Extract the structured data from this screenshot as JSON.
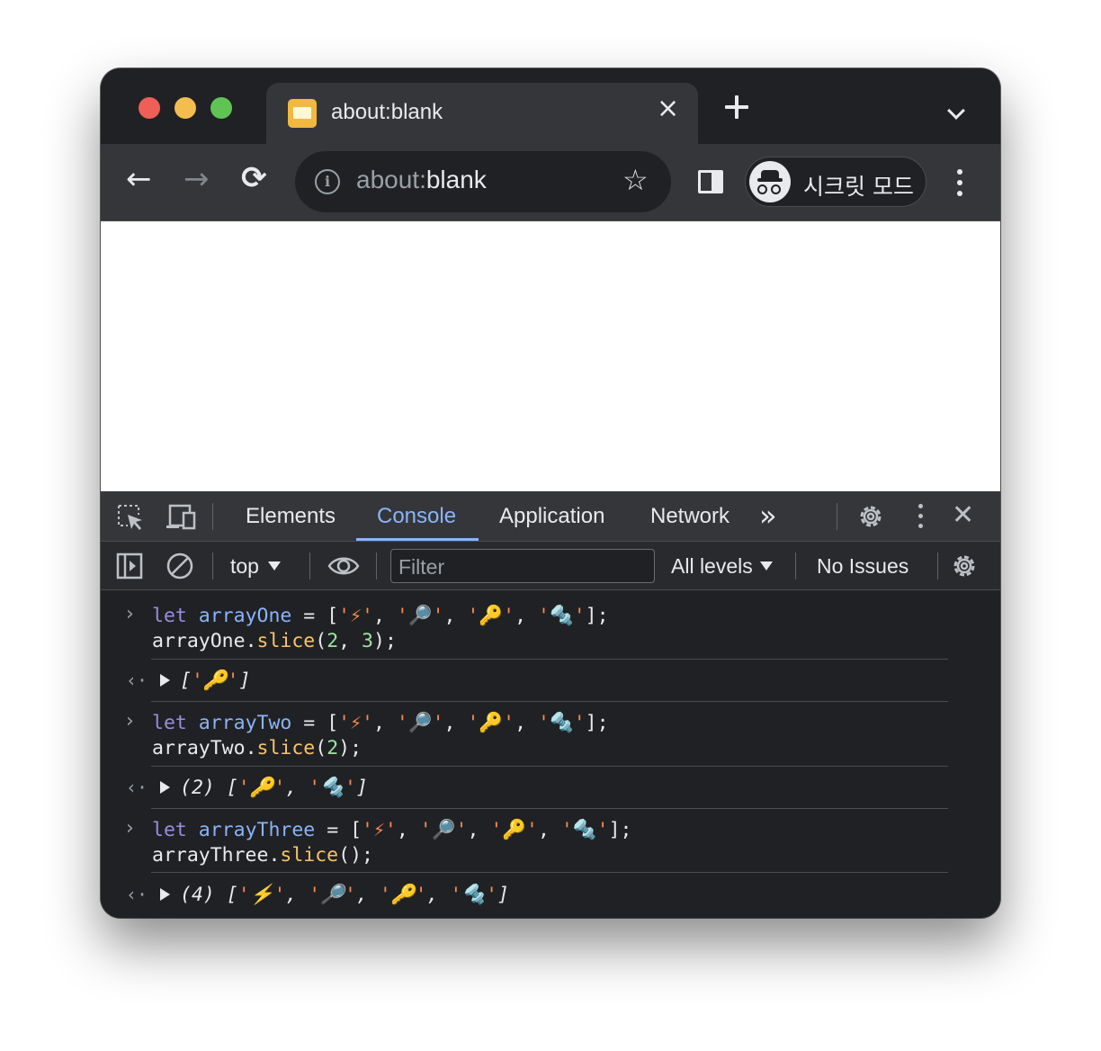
{
  "window": {
    "tab_title": "about:blank",
    "tab_close": "×",
    "favicon": "blank-page-icon",
    "new_tab": "new-tab-icon",
    "tab_search": "chevron-down-icon"
  },
  "toolbar": {
    "back": "←",
    "forward": "→",
    "reload": "⟳",
    "url_scheme": "about:",
    "url_host": "blank",
    "bookmark": "☆",
    "incognito_label": "시크릿 모드"
  },
  "devtools": {
    "tabs": [
      "Elements",
      "Console",
      "Application",
      "Network"
    ],
    "more_tabs": "»",
    "close": "✕",
    "context": "top",
    "filter_placeholder": "Filter",
    "levels": "All levels",
    "issues": "No Issues"
  },
  "console": {
    "entries": [
      {
        "kw": "let",
        "var": "arrayOne",
        "items": [
          "⚡",
          "🔎",
          "🔑",
          "🔩"
        ],
        "call_obj": "arrayOne",
        "method": "slice",
        "args": [
          "2",
          "3"
        ],
        "result_count": "",
        "result": [
          "🔑"
        ]
      },
      {
        "kw": "let",
        "var": "arrayTwo",
        "items": [
          "⚡",
          "🔎",
          "🔑",
          "🔩"
        ],
        "call_obj": "arrayTwo",
        "method": "slice",
        "args": [
          "2"
        ],
        "result_count": "(2)",
        "result": [
          "🔑",
          "🔩"
        ]
      },
      {
        "kw": "let",
        "var": "arrayThree",
        "items": [
          "⚡",
          "🔎",
          "🔑",
          "🔩"
        ],
        "call_obj": "arrayThree",
        "method": "slice",
        "args": [],
        "result_count": "(4)",
        "result": [
          "⚡",
          "🔎",
          "🔑",
          "🔩"
        ]
      }
    ]
  },
  "colors": {
    "keyword": "#9b8ce0",
    "variable": "#8ab4f8",
    "string": "#f28b54",
    "function": "#f9c46b",
    "number": "#9fe3a3"
  }
}
